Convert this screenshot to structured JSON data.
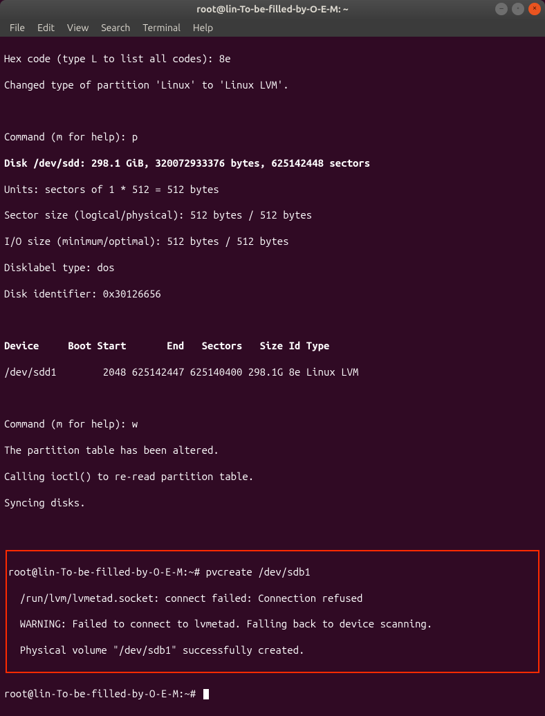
{
  "window": {
    "title": "root@lin-To-be-filled-by-O-E-M: ~"
  },
  "menubar": {
    "items": [
      "File",
      "Edit",
      "View",
      "Search",
      "Terminal",
      "Help"
    ]
  },
  "terminal": {
    "lines": {
      "l0": "Hex code (type L to list all codes): 8e",
      "l1": "Changed type of partition 'Linux' to 'Linux LVM'.",
      "l2": "",
      "l3": "Command (m for help): p",
      "l4": "Disk /dev/sdd: 298.1 GiB, 320072933376 bytes, 625142448 sectors",
      "l5": "Units: sectors of 1 * 512 = 512 bytes",
      "l6": "Sector size (logical/physical): 512 bytes / 512 bytes",
      "l7": "I/O size (minimum/optimal): 512 bytes / 512 bytes",
      "l8": "Disklabel type: dos",
      "l9": "Disk identifier: 0x30126656",
      "l10": "",
      "l11": "Device     Boot Start       End   Sectors   Size Id Type",
      "l12": "/dev/sdd1        2048 625142447 625140400 298.1G 8e Linux LVM",
      "l13": "",
      "l14": "Command (m for help): w",
      "l15": "The partition table has been altered.",
      "l16": "Calling ioctl() to re-read partition table.",
      "l17": "Syncing disks.",
      "l18": "",
      "h0": "root@lin-To-be-filled-by-O-E-M:~# pvcreate /dev/sdb1",
      "h1": "  /run/lvm/lvmetad.socket: connect failed: Connection refused",
      "h2": "  WARNING: Failed to connect to lvmetad. Falling back to device scanning.",
      "h3": "  Physical volume \"/dev/sdb1\" successfully created.",
      "p0": "root@lin-To-be-filled-by-O-E-M:~# "
    }
  }
}
